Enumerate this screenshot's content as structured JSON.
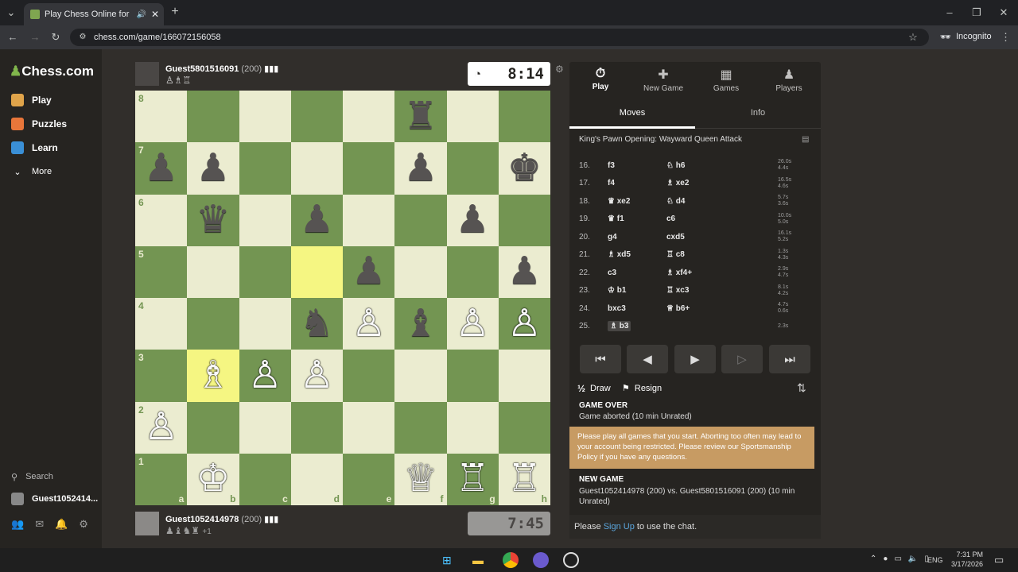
{
  "browser": {
    "tab_title": "Play Chess Online for FREE",
    "url": "chess.com/game/166072156058",
    "incognito_label": "Incognito"
  },
  "sidebar": {
    "logo": "Chess.com",
    "items": [
      {
        "label": "Play",
        "color": "#e0a44a"
      },
      {
        "label": "Puzzles",
        "color": "#e8763a"
      },
      {
        "label": "Learn",
        "color": "#3a8fd6"
      },
      {
        "label": "More",
        "color": "#cfcfcf"
      }
    ],
    "search_label": "Search",
    "user_label": "Guest1052414..."
  },
  "top_player": {
    "name": "Guest5801516091",
    "rating": "(200)",
    "clock": "8:14"
  },
  "bottom_player": {
    "name": "Guest1052414978",
    "rating": "(200)",
    "captured_extra": "+1",
    "clock": "7:45"
  },
  "board": {
    "ranks": [
      "8",
      "7",
      "6",
      "5",
      "4",
      "3",
      "2",
      "1"
    ],
    "files": [
      "a",
      "b",
      "c",
      "d",
      "e",
      "f",
      "g",
      "h"
    ],
    "highlight_squares": [
      "d5",
      "b3"
    ],
    "light_color": "#ebecd0",
    "dark_color": "#739552",
    "highlight_light": "#f5f682",
    "highlight_dark": "#b9ca43",
    "pieces": [
      {
        "sq": "f8",
        "p": "♜",
        "c": "b"
      },
      {
        "sq": "a7",
        "p": "♟",
        "c": "b"
      },
      {
        "sq": "b7",
        "p": "♟",
        "c": "b"
      },
      {
        "sq": "f7",
        "p": "♟",
        "c": "b"
      },
      {
        "sq": "h7",
        "p": "♚",
        "c": "b"
      },
      {
        "sq": "b6",
        "p": "♛",
        "c": "b"
      },
      {
        "sq": "d6",
        "p": "♟",
        "c": "b"
      },
      {
        "sq": "g6",
        "p": "♟",
        "c": "b"
      },
      {
        "sq": "e5",
        "p": "♟",
        "c": "b"
      },
      {
        "sq": "h5",
        "p": "♟",
        "c": "b"
      },
      {
        "sq": "d4",
        "p": "♞",
        "c": "b"
      },
      {
        "sq": "e4",
        "p": "♙",
        "c": "w"
      },
      {
        "sq": "f4",
        "p": "♝",
        "c": "b"
      },
      {
        "sq": "g4",
        "p": "♙",
        "c": "w"
      },
      {
        "sq": "h4",
        "p": "♙",
        "c": "w"
      },
      {
        "sq": "b3",
        "p": "♗",
        "c": "w"
      },
      {
        "sq": "c3",
        "p": "♙",
        "c": "w"
      },
      {
        "sq": "d3",
        "p": "♙",
        "c": "w"
      },
      {
        "sq": "a2",
        "p": "♙",
        "c": "w"
      },
      {
        "sq": "b1",
        "p": "♔",
        "c": "w"
      },
      {
        "sq": "f1",
        "p": "♕",
        "c": "w"
      },
      {
        "sq": "g1",
        "p": "♖",
        "c": "w"
      },
      {
        "sq": "h1",
        "p": "♖",
        "c": "w"
      }
    ]
  },
  "panel": {
    "tabs": [
      {
        "label": "Play",
        "icon": "⏱"
      },
      {
        "label": "New Game",
        "icon": "✚"
      },
      {
        "label": "Games",
        "icon": "▦"
      },
      {
        "label": "Players",
        "icon": "♟"
      }
    ],
    "subtabs": [
      "Moves",
      "Info"
    ],
    "opening": "King's Pawn Opening: Wayward Queen Attack",
    "moves": [
      {
        "n": "16.",
        "w": "f3",
        "b": "♘ h6",
        "t1": "26.0s",
        "t2": "4.4s"
      },
      {
        "n": "17.",
        "w": "f4",
        "b": "♗ xe2",
        "t1": "16.5s",
        "t2": "4.6s"
      },
      {
        "n": "18.",
        "w": "♛ xe2",
        "b": "♘ d4",
        "t1": "5.7s",
        "t2": "3.6s"
      },
      {
        "n": "19.",
        "w": "♛ f1",
        "b": "c6",
        "t1": "10.0s",
        "t2": "5.0s"
      },
      {
        "n": "20.",
        "w": "g4",
        "b": "cxd5",
        "t1": "16.1s",
        "t2": "5.2s"
      },
      {
        "n": "21.",
        "w": "♗ xd5",
        "b": "♖ c8",
        "t1": "1.3s",
        "t2": "4.3s"
      },
      {
        "n": "22.",
        "w": "c3",
        "b": "♗ xf4+",
        "t1": "2.9s",
        "t2": "4.7s"
      },
      {
        "n": "23.",
        "w": "♔ b1",
        "b": "♖ xc3",
        "t1": "8.1s",
        "t2": "4.2s"
      },
      {
        "n": "24.",
        "w": "bxc3",
        "b": "♕ b6+",
        "t1": "4.7s",
        "t2": "0.6s"
      },
      {
        "n": "25.",
        "w": "♗ b3",
        "b": "",
        "t1": "2.3s",
        "t2": ""
      }
    ],
    "nav_icons": [
      "⏮",
      "◀",
      "▶",
      "▷",
      "⏭"
    ],
    "draw_label": "Draw",
    "resign_label": "Resign",
    "game_over_title": "GAME OVER",
    "game_over_text": "Game aborted (10 min Unrated)",
    "warning_text": "Please play all games that you start. Aborting too often may lead to your account being restricted. Please review our Sportsmanship Policy if you have any questions.",
    "new_game_title": "NEW GAME",
    "new_game_text": "Guest1052414978 (200) vs. Guest5801516091 (200) (10 min Unrated)",
    "chat_prefix": "Please",
    "chat_link": "Sign Up",
    "chat_suffix": "to use the chat."
  },
  "taskbar": {
    "lang": "ENG",
    "time": "7:31 PM",
    "date": "3/17/2026"
  }
}
